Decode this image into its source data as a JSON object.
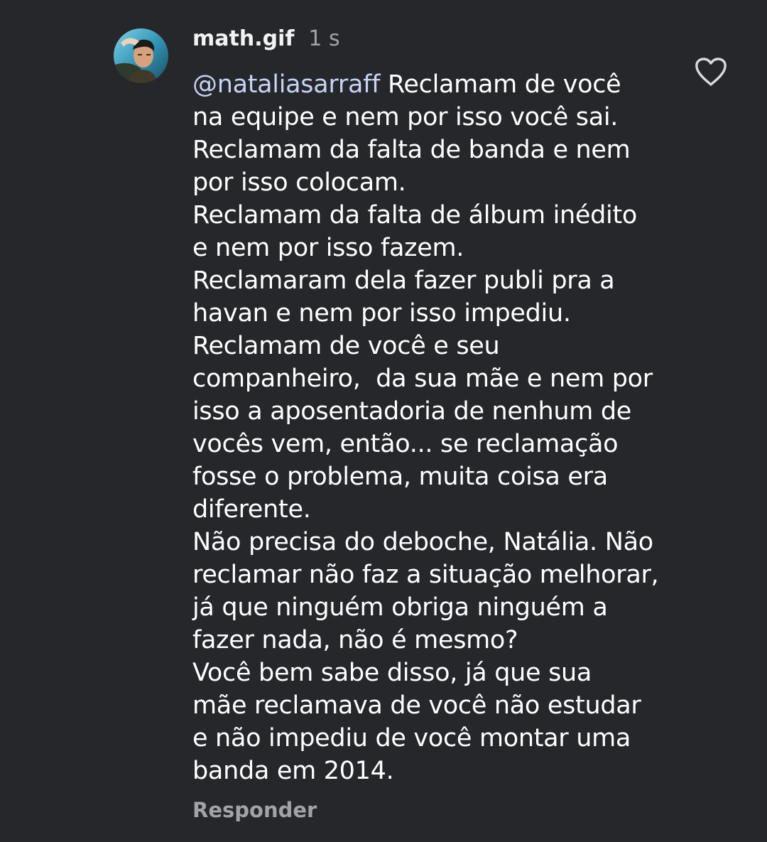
{
  "comment": {
    "username": "math.gif",
    "timestamp": "1 s",
    "mention": "@nataliasarraff",
    "lines": [
      " Reclamam de você",
      "na equipe e nem por isso você sai.",
      "Reclamam da falta de banda e nem",
      "por isso colocam.",
      "Reclamam da falta de álbum inédito",
      "e nem por isso fazem.",
      "Reclamaram dela fazer publi pra a",
      "havan e nem por isso impediu.",
      "Reclamam de você e seu",
      "companheiro,  da sua mãe e nem por",
      "isso a aposentadoria de nenhum de",
      "vocês vem, então... se reclamação",
      "fosse o problema, muita coisa era",
      "diferente.",
      "Não precisa do deboche, Natália. Não",
      "reclamar não faz a situação melhorar,",
      "já que ninguém obriga ninguém a",
      "fazer nada, não é mesmo?",
      "Você bem sabe disso, já que sua",
      "mãe reclamava de você não estudar",
      "e não impediu de você montar uma",
      "banda em 2014."
    ],
    "reply_label": "Responder"
  },
  "icons": {
    "like": "heart-outline-icon",
    "avatar": "user-avatar"
  },
  "colors": {
    "background": "#25272b",
    "text": "#ffffff",
    "muted": "#a0a3a8",
    "mention": "#c6d3f5"
  }
}
